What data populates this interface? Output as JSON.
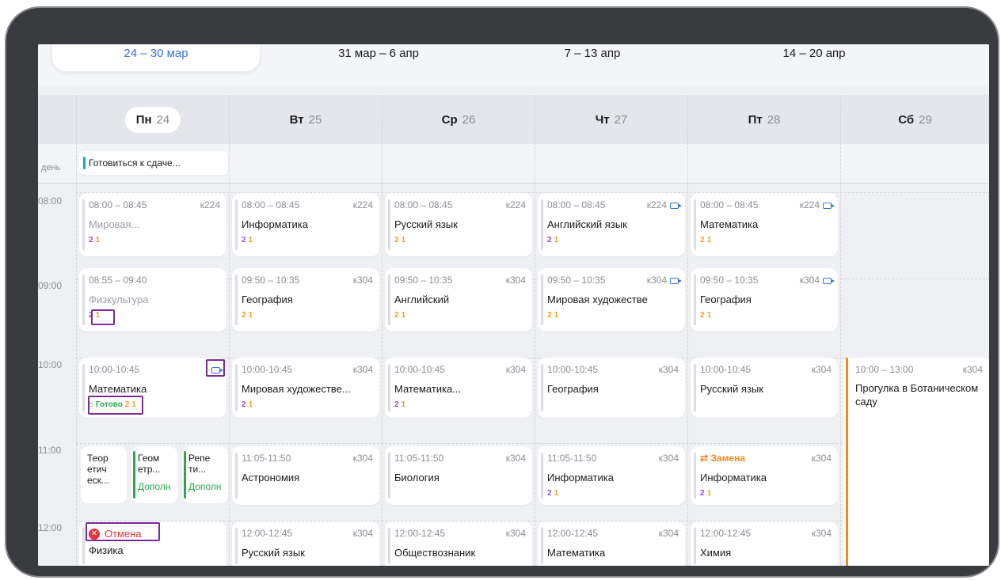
{
  "weeks": [
    {
      "label": "24 – 30 мар",
      "active": true
    },
    {
      "label": "31 мар – 6 апр"
    },
    {
      "label": "7 – 13 апр"
    },
    {
      "label": "14 – 20 апр"
    }
  ],
  "days": [
    {
      "name": "Пн",
      "num": "24"
    },
    {
      "name": "Вт",
      "num": "25"
    },
    {
      "name": "Ср",
      "num": "26"
    },
    {
      "name": "Чт",
      "num": "27"
    },
    {
      "name": "Пт",
      "num": "28"
    },
    {
      "name": "Сб",
      "num": "29"
    }
  ],
  "allday": {
    "label": "день",
    "event": "Готовиться к сдаче..."
  },
  "times": [
    "08:00",
    "09:00",
    "10:00",
    "11:00",
    "12:00"
  ],
  "badge": {
    "a": "2",
    "b": "1"
  },
  "mon": {
    "l1": {
      "time": "08:00 – 08:45",
      "room": "к224",
      "title": "Мировая..."
    },
    "l2": {
      "time": "08:55 – 09:40",
      "title": "Физкультура"
    },
    "l3": {
      "time": "10:00-10:45",
      "title": "Математика",
      "ready": "Готово"
    },
    "mini": [
      {
        "title": "Теор\nетич\nеск..."
      },
      {
        "title": "Геом\nетр...",
        "sub": "Дополн"
      },
      {
        "title": "Репе\nти...",
        "sub": "Дополн"
      }
    ],
    "l5": {
      "status": "Отмена",
      "title": "Физика"
    }
  },
  "tue": [
    {
      "time": "08:00 – 08:45",
      "room": "к224",
      "title": "Информатика"
    },
    {
      "time": "09:50 – 10:35",
      "room": "к304",
      "title": "География"
    },
    {
      "time": "10:00-10:45",
      "room": "к304",
      "title": "Мировая художестве..."
    },
    {
      "time": "11:05-11:50",
      "room": "к304",
      "title": "Астрономия"
    },
    {
      "time": "12:00-12:45",
      "room": "к304",
      "title": "Русский язык"
    }
  ],
  "wed": [
    {
      "time": "08:00 – 08:45",
      "room": "к224",
      "title": "Русский язык"
    },
    {
      "time": "09:50 – 10:35",
      "room": "к304",
      "title": "Английский"
    },
    {
      "time": "10:00-10:45",
      "room": "к304",
      "title": "Математика..."
    },
    {
      "time": "11:05-11:50",
      "room": "к304",
      "title": "Биология"
    },
    {
      "time": "12:00-12:45",
      "room": "к304",
      "title": "Обществознаник"
    }
  ],
  "thu": [
    {
      "time": "08:00 – 08:45",
      "room": "к224",
      "title": "Английский язык"
    },
    {
      "time": "09:50 – 10:35",
      "room": "к304",
      "title": "Мировая художестве"
    },
    {
      "time": "10:00-10:45",
      "room": "к304",
      "title": "География"
    },
    {
      "time": "11:05-11:50",
      "room": "к304",
      "title": "Информатика"
    },
    {
      "time": "12:00-12:45",
      "room": "к304",
      "title": "Математика"
    }
  ],
  "fri": [
    {
      "time": "08:00 – 08:45",
      "room": "к224",
      "title": "Математика"
    },
    {
      "time": "09:50 – 10:35",
      "room": "к304",
      "title": "География"
    },
    {
      "time": "10:00-10:45",
      "room": "к304",
      "title": "Русский язык"
    },
    {
      "status": "Замена",
      "room": "к304",
      "title": "Информатика"
    },
    {
      "time": "12:00-12:45",
      "room": "к304",
      "title": "Химия"
    }
  ],
  "sat": {
    "time": "10:00 – 13:00",
    "room": "к304",
    "title": "Прогулка в Ботаническом саду"
  }
}
